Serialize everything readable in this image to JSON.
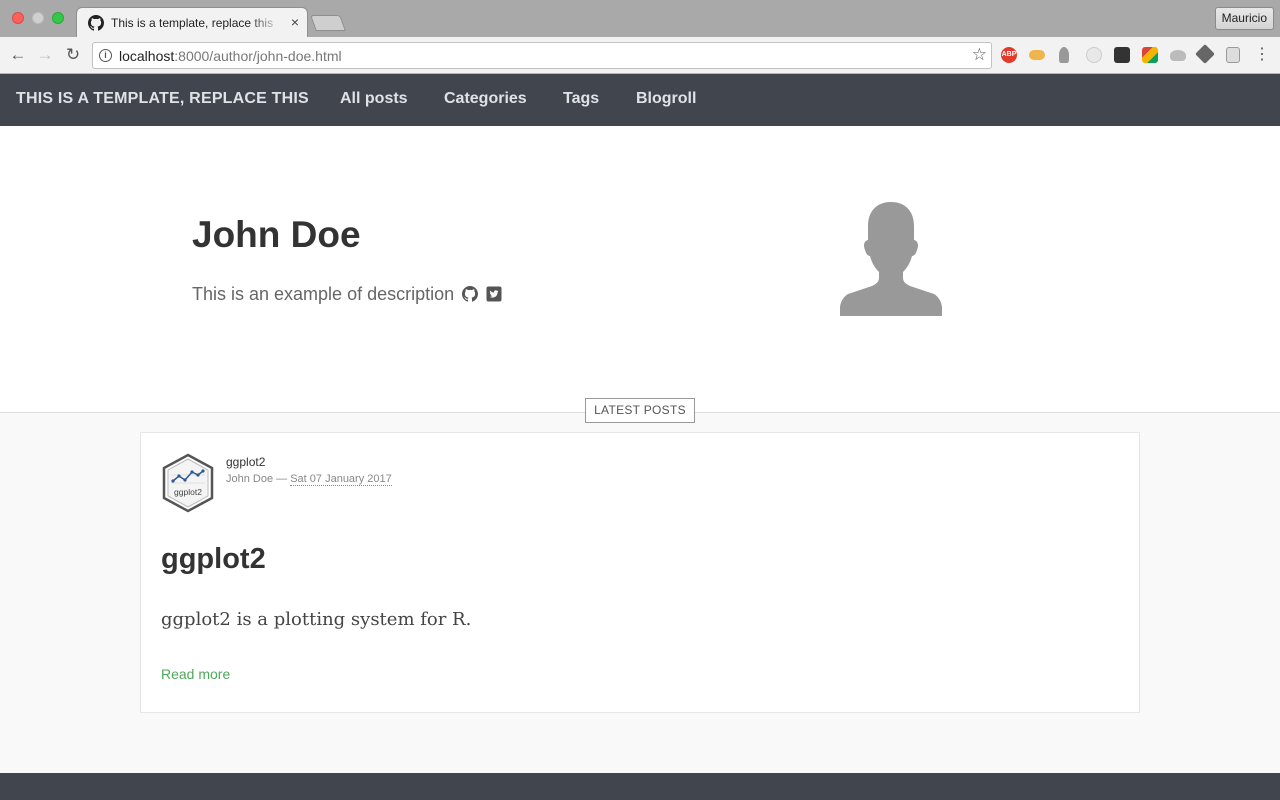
{
  "browser": {
    "tab_title": "This is a template, replace this",
    "tab_close": "×",
    "profile": "Mauricio",
    "url_host": "localhost",
    "url_path": ":8000/author/john-doe.html",
    "icons": [
      "back-arrow-icon",
      "forward-arrow-icon",
      "reload-icon",
      "info-icon",
      "star-icon",
      "menu-icon"
    ],
    "extension_badge": "ABP"
  },
  "sitenav": {
    "brand": "THIS IS A TEMPLATE, REPLACE THIS",
    "links": [
      "All posts",
      "Categories",
      "Tags",
      "Blogroll"
    ]
  },
  "author": {
    "name": "John Doe",
    "description": "This is an example of description",
    "icons": [
      "github-icon",
      "twitter-square-icon"
    ]
  },
  "latest_label": "LATEST POSTS",
  "post": {
    "meta_title": "ggplot2",
    "author": "John Doe",
    "separator": "—",
    "date": "Sat 07 January 2017",
    "thumb_text": "ggplot2",
    "title": "ggplot2",
    "excerpt": "ggplot2 is a plotting system for R.",
    "read_more": "Read more"
  },
  "colors": {
    "nav_bg": "#41454e",
    "link_green": "#4fa85c"
  }
}
